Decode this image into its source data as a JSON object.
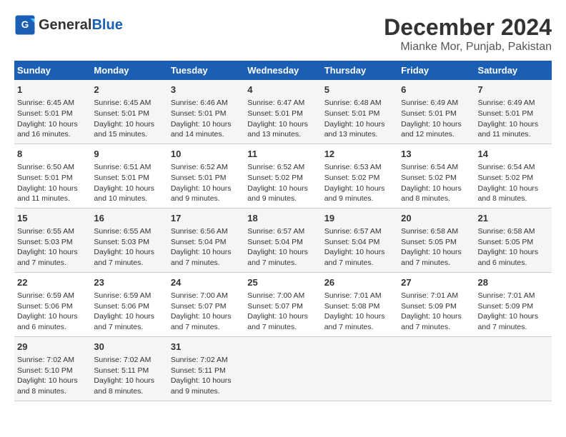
{
  "header": {
    "logo_line1": "General",
    "logo_line2": "Blue",
    "month": "December 2024",
    "location": "Mianke Mor, Punjab, Pakistan"
  },
  "weekdays": [
    "Sunday",
    "Monday",
    "Tuesday",
    "Wednesday",
    "Thursday",
    "Friday",
    "Saturday"
  ],
  "weeks": [
    [
      {
        "day": "1",
        "sunrise": "Sunrise: 6:45 AM",
        "sunset": "Sunset: 5:01 PM",
        "daylight": "Daylight: 10 hours and 16 minutes."
      },
      {
        "day": "2",
        "sunrise": "Sunrise: 6:45 AM",
        "sunset": "Sunset: 5:01 PM",
        "daylight": "Daylight: 10 hours and 15 minutes."
      },
      {
        "day": "3",
        "sunrise": "Sunrise: 6:46 AM",
        "sunset": "Sunset: 5:01 PM",
        "daylight": "Daylight: 10 hours and 14 minutes."
      },
      {
        "day": "4",
        "sunrise": "Sunrise: 6:47 AM",
        "sunset": "Sunset: 5:01 PM",
        "daylight": "Daylight: 10 hours and 13 minutes."
      },
      {
        "day": "5",
        "sunrise": "Sunrise: 6:48 AM",
        "sunset": "Sunset: 5:01 PM",
        "daylight": "Daylight: 10 hours and 13 minutes."
      },
      {
        "day": "6",
        "sunrise": "Sunrise: 6:49 AM",
        "sunset": "Sunset: 5:01 PM",
        "daylight": "Daylight: 10 hours and 12 minutes."
      },
      {
        "day": "7",
        "sunrise": "Sunrise: 6:49 AM",
        "sunset": "Sunset: 5:01 PM",
        "daylight": "Daylight: 10 hours and 11 minutes."
      }
    ],
    [
      {
        "day": "8",
        "sunrise": "Sunrise: 6:50 AM",
        "sunset": "Sunset: 5:01 PM",
        "daylight": "Daylight: 10 hours and 11 minutes."
      },
      {
        "day": "9",
        "sunrise": "Sunrise: 6:51 AM",
        "sunset": "Sunset: 5:01 PM",
        "daylight": "Daylight: 10 hours and 10 minutes."
      },
      {
        "day": "10",
        "sunrise": "Sunrise: 6:52 AM",
        "sunset": "Sunset: 5:01 PM",
        "daylight": "Daylight: 10 hours and 9 minutes."
      },
      {
        "day": "11",
        "sunrise": "Sunrise: 6:52 AM",
        "sunset": "Sunset: 5:02 PM",
        "daylight": "Daylight: 10 hours and 9 minutes."
      },
      {
        "day": "12",
        "sunrise": "Sunrise: 6:53 AM",
        "sunset": "Sunset: 5:02 PM",
        "daylight": "Daylight: 10 hours and 9 minutes."
      },
      {
        "day": "13",
        "sunrise": "Sunrise: 6:54 AM",
        "sunset": "Sunset: 5:02 PM",
        "daylight": "Daylight: 10 hours and 8 minutes."
      },
      {
        "day": "14",
        "sunrise": "Sunrise: 6:54 AM",
        "sunset": "Sunset: 5:02 PM",
        "daylight": "Daylight: 10 hours and 8 minutes."
      }
    ],
    [
      {
        "day": "15",
        "sunrise": "Sunrise: 6:55 AM",
        "sunset": "Sunset: 5:03 PM",
        "daylight": "Daylight: 10 hours and 7 minutes."
      },
      {
        "day": "16",
        "sunrise": "Sunrise: 6:55 AM",
        "sunset": "Sunset: 5:03 PM",
        "daylight": "Daylight: 10 hours and 7 minutes."
      },
      {
        "day": "17",
        "sunrise": "Sunrise: 6:56 AM",
        "sunset": "Sunset: 5:04 PM",
        "daylight": "Daylight: 10 hours and 7 minutes."
      },
      {
        "day": "18",
        "sunrise": "Sunrise: 6:57 AM",
        "sunset": "Sunset: 5:04 PM",
        "daylight": "Daylight: 10 hours and 7 minutes."
      },
      {
        "day": "19",
        "sunrise": "Sunrise: 6:57 AM",
        "sunset": "Sunset: 5:04 PM",
        "daylight": "Daylight: 10 hours and 7 minutes."
      },
      {
        "day": "20",
        "sunrise": "Sunrise: 6:58 AM",
        "sunset": "Sunset: 5:05 PM",
        "daylight": "Daylight: 10 hours and 7 minutes."
      },
      {
        "day": "21",
        "sunrise": "Sunrise: 6:58 AM",
        "sunset": "Sunset: 5:05 PM",
        "daylight": "Daylight: 10 hours and 6 minutes."
      }
    ],
    [
      {
        "day": "22",
        "sunrise": "Sunrise: 6:59 AM",
        "sunset": "Sunset: 5:06 PM",
        "daylight": "Daylight: 10 hours and 6 minutes."
      },
      {
        "day": "23",
        "sunrise": "Sunrise: 6:59 AM",
        "sunset": "Sunset: 5:06 PM",
        "daylight": "Daylight: 10 hours and 7 minutes."
      },
      {
        "day": "24",
        "sunrise": "Sunrise: 7:00 AM",
        "sunset": "Sunset: 5:07 PM",
        "daylight": "Daylight: 10 hours and 7 minutes."
      },
      {
        "day": "25",
        "sunrise": "Sunrise: 7:00 AM",
        "sunset": "Sunset: 5:07 PM",
        "daylight": "Daylight: 10 hours and 7 minutes."
      },
      {
        "day": "26",
        "sunrise": "Sunrise: 7:01 AM",
        "sunset": "Sunset: 5:08 PM",
        "daylight": "Daylight: 10 hours and 7 minutes."
      },
      {
        "day": "27",
        "sunrise": "Sunrise: 7:01 AM",
        "sunset": "Sunset: 5:09 PM",
        "daylight": "Daylight: 10 hours and 7 minutes."
      },
      {
        "day": "28",
        "sunrise": "Sunrise: 7:01 AM",
        "sunset": "Sunset: 5:09 PM",
        "daylight": "Daylight: 10 hours and 7 minutes."
      }
    ],
    [
      {
        "day": "29",
        "sunrise": "Sunrise: 7:02 AM",
        "sunset": "Sunset: 5:10 PM",
        "daylight": "Daylight: 10 hours and 8 minutes."
      },
      {
        "day": "30",
        "sunrise": "Sunrise: 7:02 AM",
        "sunset": "Sunset: 5:11 PM",
        "daylight": "Daylight: 10 hours and 8 minutes."
      },
      {
        "day": "31",
        "sunrise": "Sunrise: 7:02 AM",
        "sunset": "Sunset: 5:11 PM",
        "daylight": "Daylight: 10 hours and 9 minutes."
      },
      null,
      null,
      null,
      null
    ]
  ]
}
